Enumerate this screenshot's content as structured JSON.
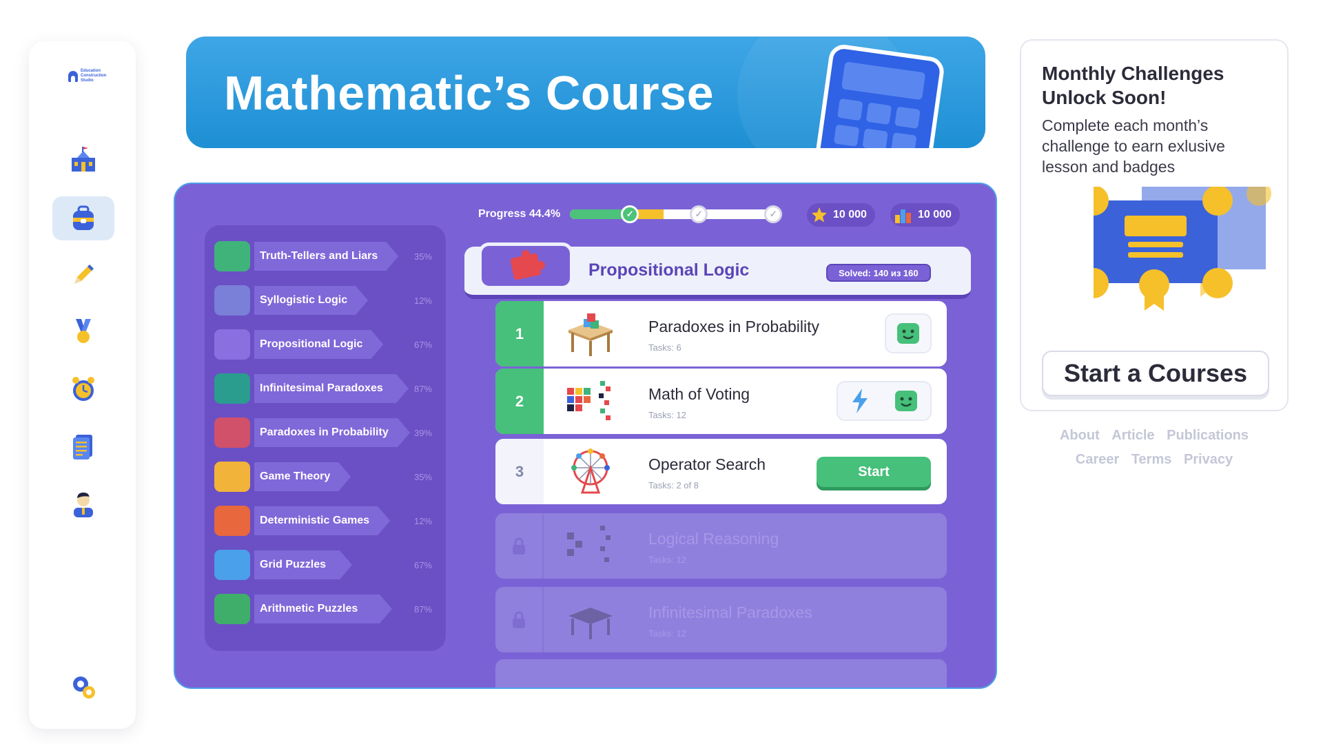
{
  "sidebar": {
    "logo_text": "Education Construction Studio",
    "items": [
      {
        "name": "school"
      },
      {
        "name": "backpack",
        "active": true
      },
      {
        "name": "pencil"
      },
      {
        "name": "medal"
      },
      {
        "name": "alarm-clock"
      },
      {
        "name": "notes"
      },
      {
        "name": "profile"
      }
    ],
    "settings": "settings"
  },
  "banner": {
    "title": "Mathematic’s Course"
  },
  "progress": {
    "label": "Progress 44.4%",
    "value": 0.444
  },
  "stats": {
    "stars": "10 000",
    "rating": "10 000"
  },
  "topics": [
    {
      "label": "Truth-Tellers and Liars",
      "pct": "35%",
      "color": "#3fb37a"
    },
    {
      "label": "Syllogistic Logic",
      "pct": "12%",
      "color": "#7a7fd8"
    },
    {
      "label": "Propositional Logic",
      "pct": "67%",
      "color": "#8a6fe0"
    },
    {
      "label": "Infinitesimal Paradoxes",
      "pct": "87%",
      "color": "#2a9d8f"
    },
    {
      "label": "Paradoxes in Probability",
      "pct": "39%",
      "color": "#d1506a"
    },
    {
      "label": "Game Theory",
      "pct": "35%",
      "color": "#f2b33a"
    },
    {
      "label": "Deterministic Games",
      "pct": "12%",
      "color": "#e8673d"
    },
    {
      "label": "Grid Puzzles",
      "pct": "67%",
      "color": "#4aa0ea"
    },
    {
      "label": "Arithmetic Puzzles",
      "pct": "87%",
      "color": "#3fae6a"
    }
  ],
  "course": {
    "title": "Propositional Logic",
    "solved": "Solved: 140 из 160"
  },
  "lessons": [
    {
      "num": "1",
      "title": "Paradoxes in Probability",
      "tasks": "Tasks: 6",
      "state": "done"
    },
    {
      "num": "2",
      "title": "Math of Voting",
      "tasks": "Tasks: 12",
      "state": "done"
    },
    {
      "num": "3",
      "title": "Operator Search",
      "tasks": "Tasks: 2 of 8",
      "state": "current",
      "button": "Start"
    },
    {
      "num": "",
      "title": "Logical Reasoning",
      "tasks": "Tasks: 12",
      "state": "locked"
    },
    {
      "num": "",
      "title": "Infinitesimal Paradoxes",
      "tasks": "Tasks: 12",
      "state": "locked"
    }
  ],
  "promo": {
    "title": "Monthly Challenges Unlock Soon!",
    "text": "Complete each month’s challenge to earn exlusive lesson and badges",
    "button": "Start a Courses"
  },
  "footer": {
    "row1": [
      "About",
      "Article",
      "Publications"
    ],
    "row2": [
      "Career",
      "Terms",
      "Privacy"
    ]
  },
  "colors": {
    "accent": "#7a62d6",
    "green": "#46c07a",
    "banner": "#2a9ae0"
  }
}
